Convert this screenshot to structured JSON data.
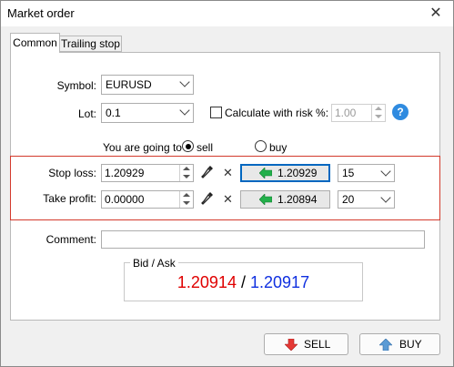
{
  "window": {
    "title": "Market order"
  },
  "tabs": [
    {
      "label": "Common",
      "active": true
    },
    {
      "label": "Trailing stop",
      "active": false
    }
  ],
  "form": {
    "symbol_label": "Symbol:",
    "symbol_value": "EURUSD",
    "lot_label": "Lot:",
    "lot_value": "0.1",
    "risk_label": "Calculate with risk %:",
    "risk_checked": false,
    "risk_value": "1.00",
    "help_glyph": "?",
    "direction_label": "You are going to",
    "direction_options": [
      {
        "label": "sell",
        "selected": true
      },
      {
        "label": "buy",
        "selected": false
      }
    ],
    "stop_loss": {
      "label": "Stop loss:",
      "value": "1.20929",
      "price_button": "1.20929",
      "points": "15"
    },
    "take_profit": {
      "label": "Take profit:",
      "value": "0.00000",
      "price_button": "1.20894",
      "points": "20"
    },
    "comment_label": "Comment:",
    "comment_value": ""
  },
  "quote": {
    "label": "Bid / Ask",
    "bid": "1.20914",
    "separator": "/",
    "ask": "1.20917",
    "bid_color": "#e00000",
    "ask_color": "#1030e0"
  },
  "buttons": {
    "sell_label": "SELL",
    "buy_label": "BUY"
  },
  "icons": {
    "close": "close-icon",
    "picker": "eyedropper-icon",
    "clear": "x-icon",
    "price_arrow": "green-left-arrow-icon",
    "sell_arrow": "red-down-arrow-icon",
    "buy_arrow": "blue-up-arrow-icon",
    "help": "help-icon"
  }
}
